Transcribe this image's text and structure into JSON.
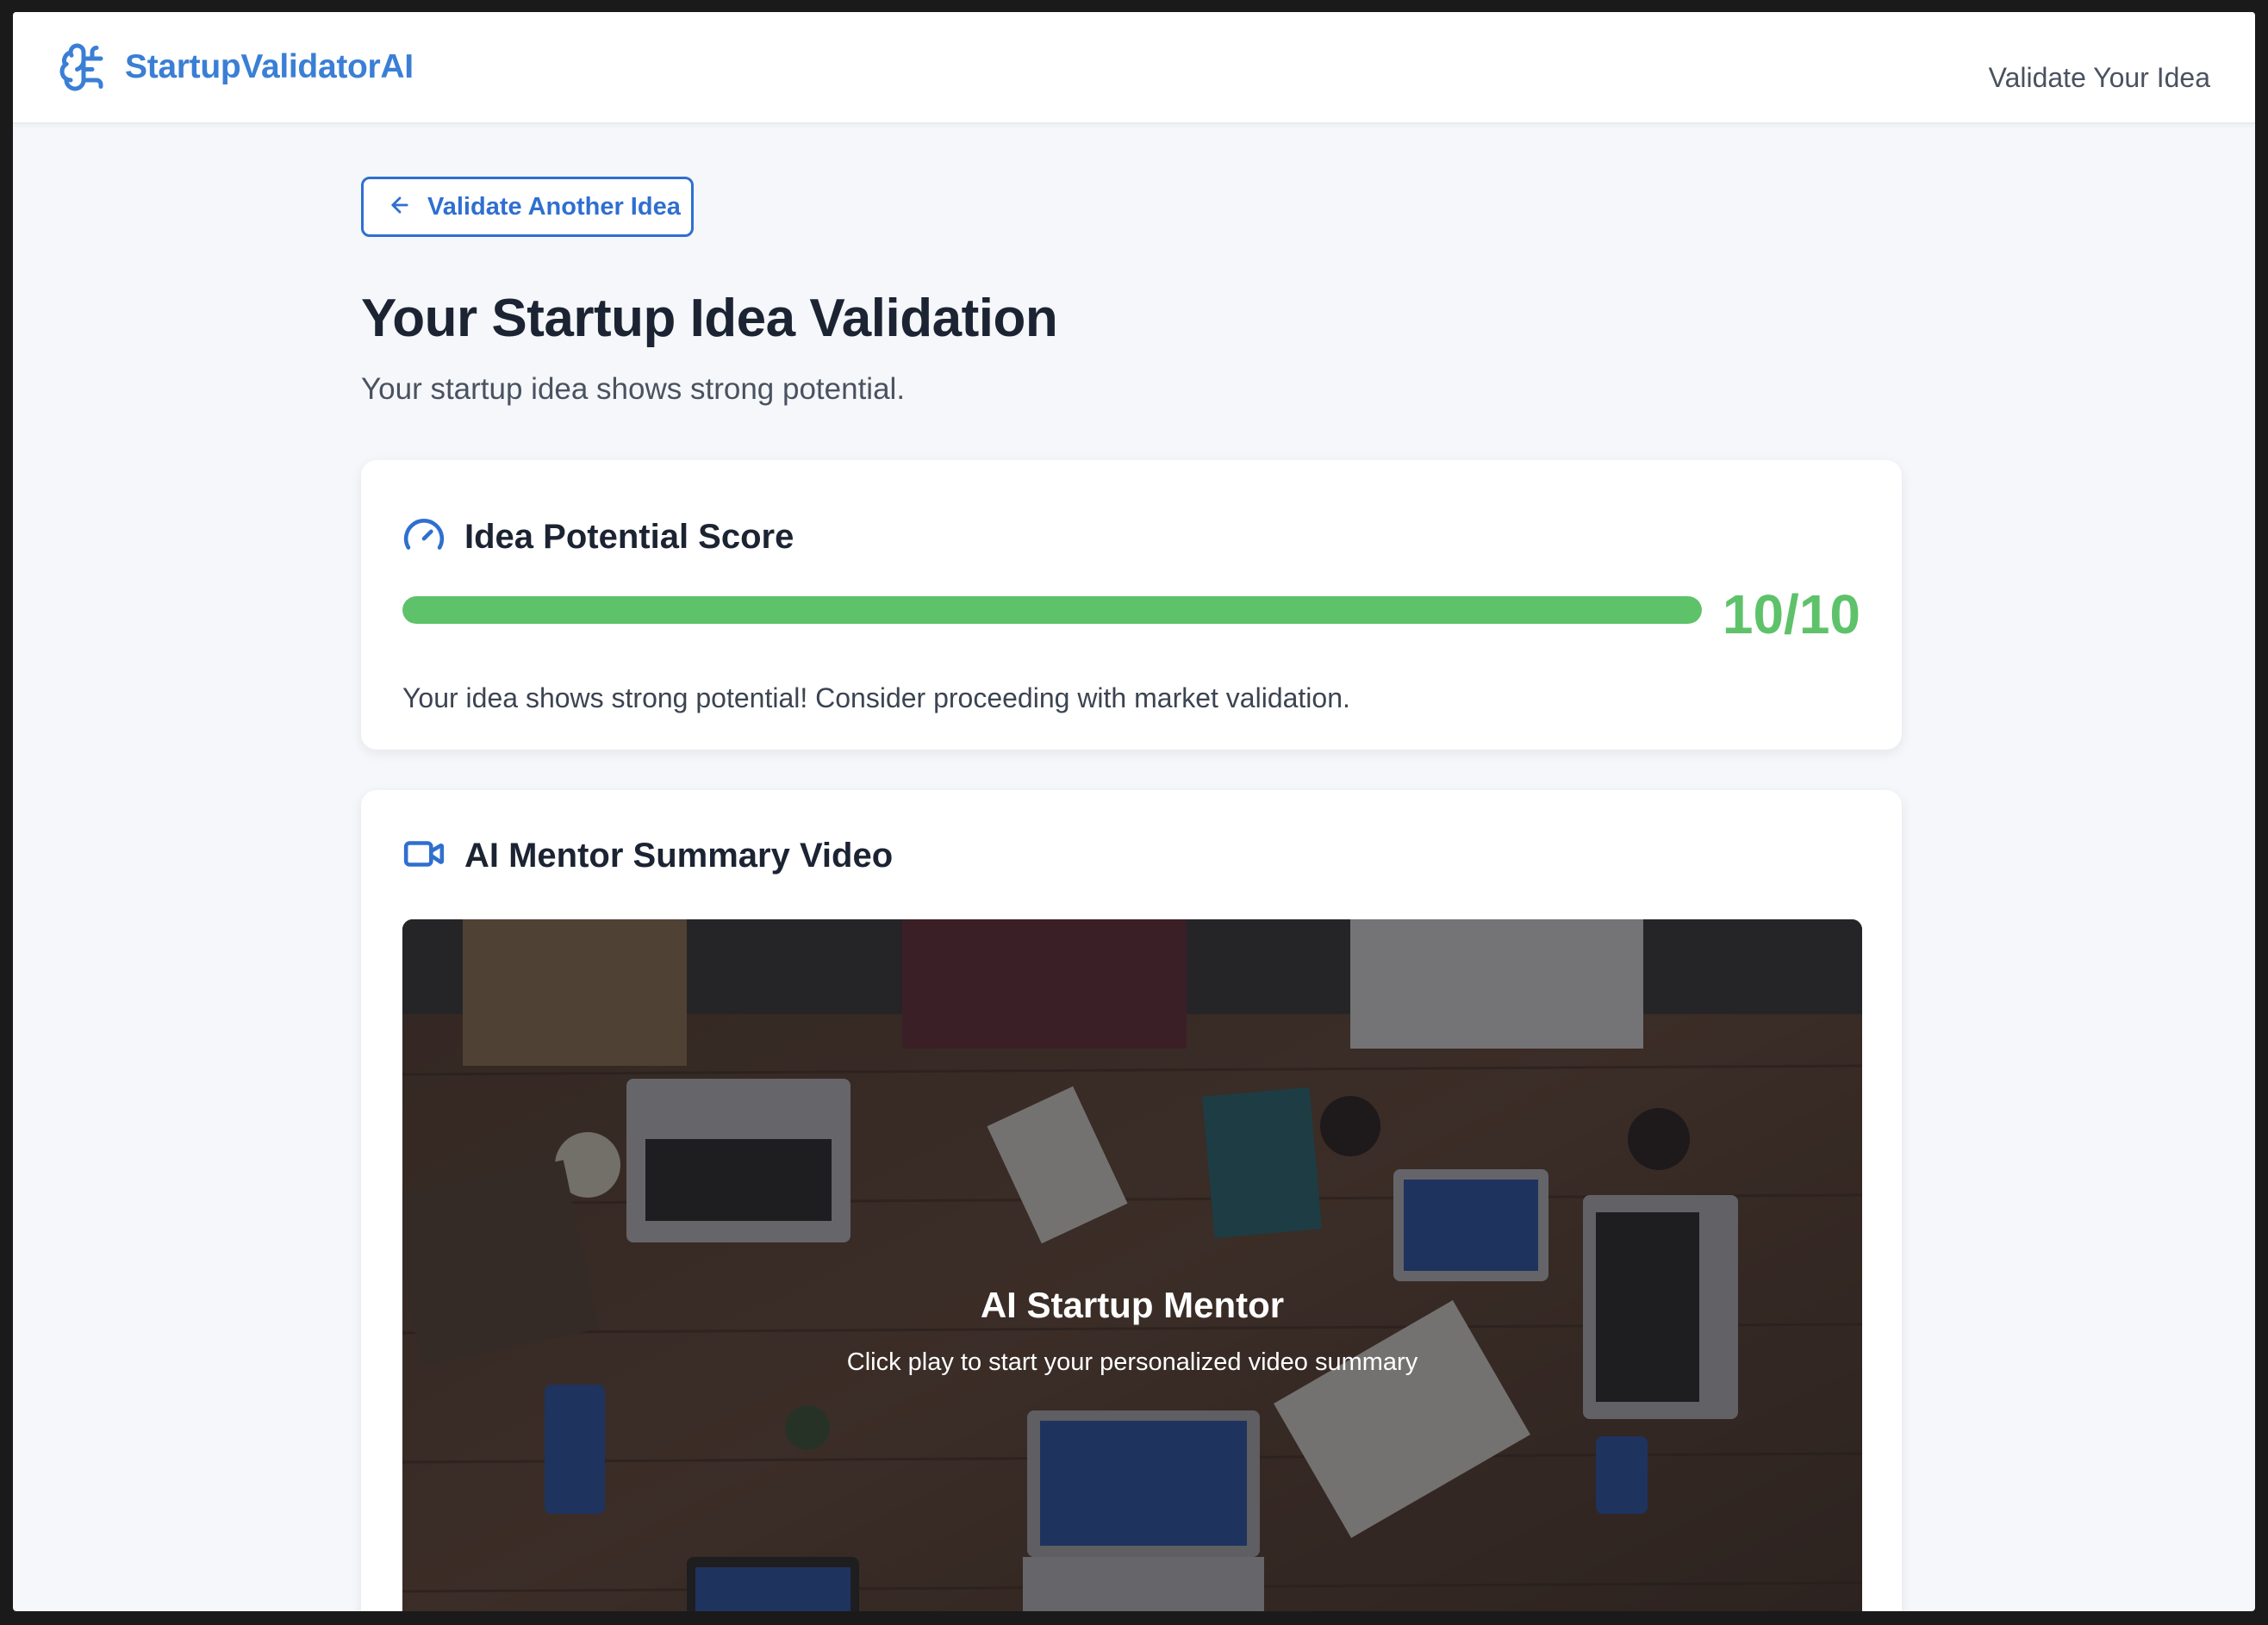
{
  "header": {
    "brand_name": "StartupValidatorAI",
    "brand_icon": "brain-icon",
    "nav_link": "Validate Your Idea"
  },
  "back_button": {
    "label": "Validate Another Idea",
    "icon": "arrow-left-icon"
  },
  "page": {
    "title": "Your Startup Idea Validation",
    "subtitle": "Your startup idea shows strong potential."
  },
  "score_card": {
    "icon": "gauge-icon",
    "title": "Idea Potential Score",
    "score_value": "10/10",
    "progress_fraction": 1.0,
    "message": "Your idea shows strong potential! Consider proceeding with market validation."
  },
  "video_card": {
    "icon": "video-camera-icon",
    "title": "AI Mentor Summary Video",
    "overlay_title": "AI Startup Mentor",
    "overlay_subtitle": "Click play to start your personalized video summary"
  },
  "colors": {
    "brand": "#3a7fd5",
    "accent": "#2f6fd0",
    "success": "#5ec26a",
    "heading": "#1c2433"
  }
}
